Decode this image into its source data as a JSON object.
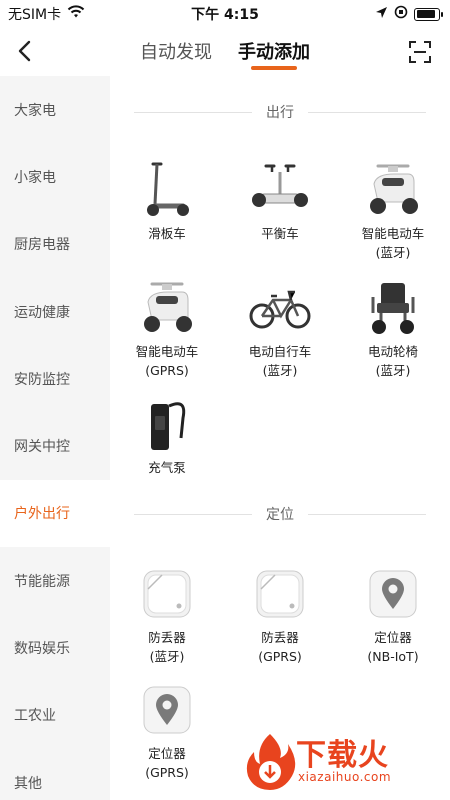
{
  "status_bar": {
    "carrier": "无SIM卡",
    "time": "下午 4:15",
    "battery_level": 0.9
  },
  "nav": {
    "tabs": [
      {
        "label": "自动发现",
        "active": false
      },
      {
        "label": "手动添加",
        "active": true
      }
    ],
    "back_icon": "chevron-left-icon",
    "scan_icon": "scan-icon"
  },
  "sidebar": {
    "items": [
      {
        "label": "大家电"
      },
      {
        "label": "小家电"
      },
      {
        "label": "厨房电器"
      },
      {
        "label": "运动健康"
      },
      {
        "label": "安防监控"
      },
      {
        "label": "网关中控"
      },
      {
        "label": "户外出行",
        "active": true
      },
      {
        "label": "节能能源"
      },
      {
        "label": "数码娱乐"
      },
      {
        "label": "工农业"
      },
      {
        "label": "其他"
      }
    ]
  },
  "sections": [
    {
      "title": "出行",
      "devices": [
        {
          "name": "滑板车",
          "sub": "",
          "icon": "scooter-icon"
        },
        {
          "name": "平衡车",
          "sub": "",
          "icon": "balance-scooter-icon"
        },
        {
          "name": "智能电动车",
          "sub": "(蓝牙)",
          "icon": "e-moped-icon"
        },
        {
          "name": "智能电动车",
          "sub": "(GPRS)",
          "icon": "e-moped-icon"
        },
        {
          "name": "电动自行车",
          "sub": "(蓝牙)",
          "icon": "e-bike-icon"
        },
        {
          "name": "电动轮椅",
          "sub": "(蓝牙)",
          "icon": "wheelchair-icon"
        },
        {
          "name": "充气泵",
          "sub": "",
          "icon": "air-pump-icon"
        }
      ]
    },
    {
      "title": "定位",
      "devices": [
        {
          "name": "防丢器",
          "sub": "(蓝牙)",
          "icon": "tracker-tag-icon"
        },
        {
          "name": "防丢器",
          "sub": "(GPRS)",
          "icon": "tracker-tag-icon"
        },
        {
          "name": "定位器",
          "sub": "(NB-IoT)",
          "icon": "locator-icon"
        },
        {
          "name": "定位器",
          "sub": "(GPRS)",
          "icon": "locator-icon"
        }
      ]
    }
  ],
  "watermark": {
    "cn": "下载火",
    "en": "xiazaihuo.com"
  },
  "colors": {
    "accent": "#e8641b",
    "sidebar_bg": "#f5f5f5",
    "watermark": "#e8441e"
  }
}
